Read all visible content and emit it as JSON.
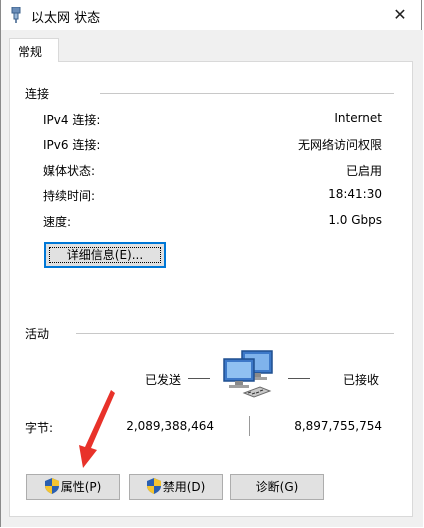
{
  "window": {
    "title": "以太网 状态",
    "icon": "network-adapter-icon",
    "close_glyph": "✕"
  },
  "tabs": [
    {
      "label": "常规",
      "active": true
    }
  ],
  "connection": {
    "section_label": "连接",
    "rows": [
      {
        "label": "IPv4 连接:",
        "value": "Internet"
      },
      {
        "label": "IPv6 连接:",
        "value": "无网络访问权限"
      },
      {
        "label": "媒体状态:",
        "value": "已启用"
      },
      {
        "label": "持续时间:",
        "value": "18:41:30"
      },
      {
        "label": "速度:",
        "value": "1.0 Gbps"
      }
    ],
    "details_button": "详细信息(E)..."
  },
  "activity": {
    "section_label": "活动",
    "sent_label": "已发送",
    "received_label": "已接收",
    "bytes_label": "字节:",
    "bytes_sent": "2,089,388,464",
    "bytes_received": "8,897,755,754",
    "icon": "network-computers-icon"
  },
  "buttons": {
    "properties": "属性(P)",
    "disable": "禁用(D)",
    "diagnose": "诊断(G)"
  },
  "colors": {
    "accent": "#0078d7",
    "annotation_arrow": "#e8322a",
    "button_face": "#e1e1e1",
    "dialog_background": "#f0f0f0"
  }
}
